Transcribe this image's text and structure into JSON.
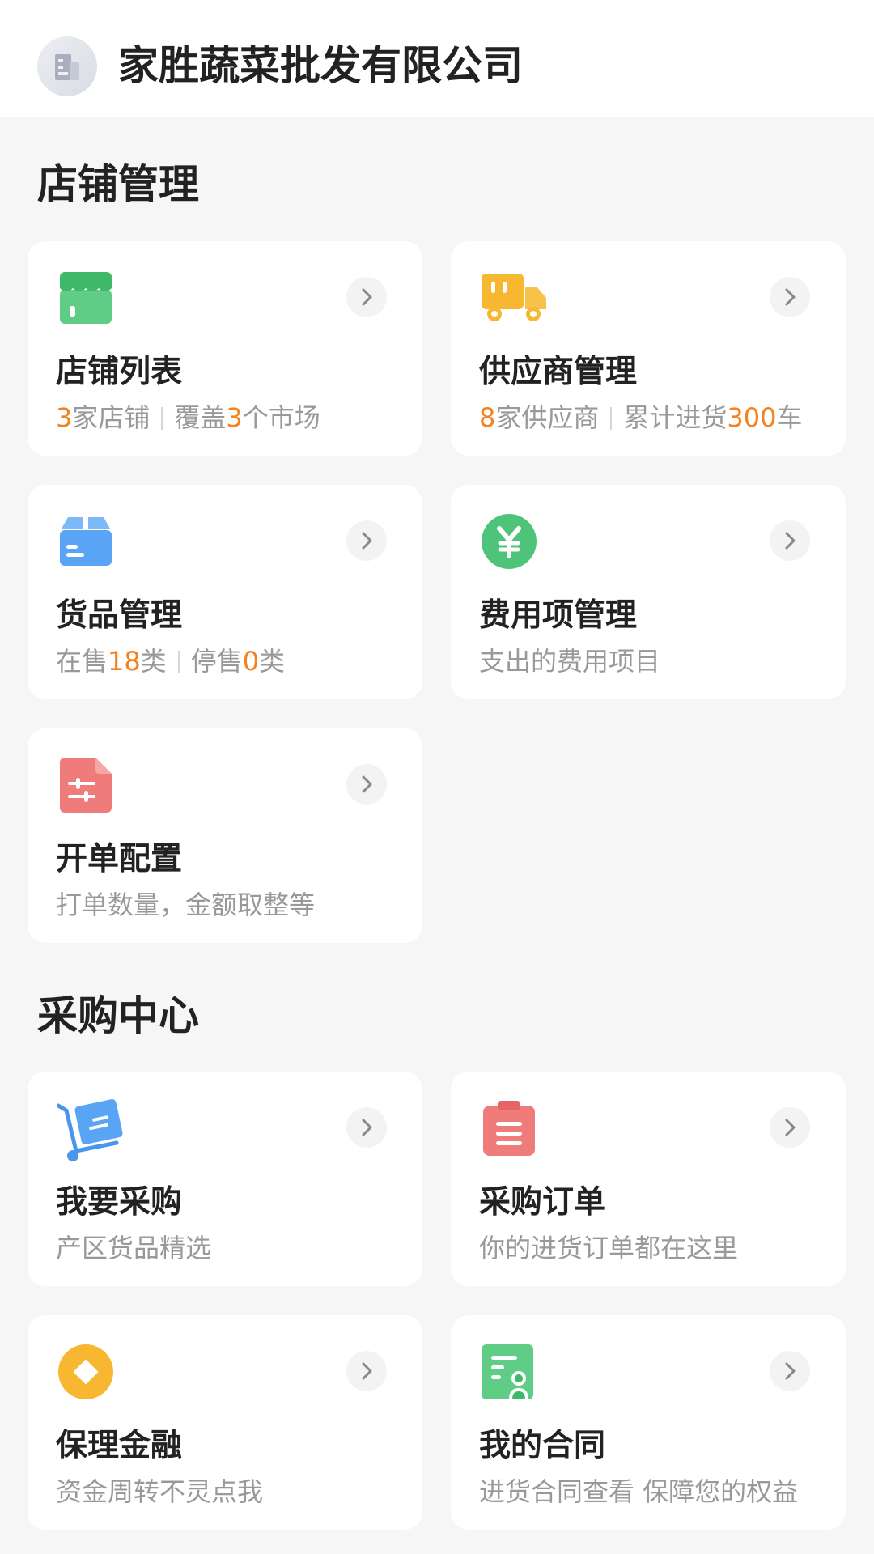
{
  "header": {
    "company_name": "家胜蔬菜批发有限公司",
    "logo_icon": "building-icon"
  },
  "colors": {
    "accent": "#f5821f",
    "page_bg": "#f6f6f6",
    "card_bg": "#ffffff",
    "subtext": "#999999"
  },
  "store_section": {
    "title": "店铺管理",
    "store_list": {
      "title": "店铺列表",
      "count": "3",
      "count_suffix": "家店铺",
      "cover_prefix": "覆盖",
      "cover_count": "3",
      "cover_suffix": "个市场",
      "icon": "storefront-icon"
    },
    "suppliers": {
      "title": "供应商管理",
      "count": "8",
      "count_suffix": "家供应商",
      "total_prefix": "累计进货",
      "total_count": "300",
      "total_suffix": "车",
      "icon": "truck-icon"
    },
    "goods": {
      "title": "货品管理",
      "on_sale_prefix": "在售",
      "on_sale_count": "18",
      "on_sale_suffix": "类",
      "off_sale_prefix": "停售",
      "off_sale_count": "0",
      "off_sale_suffix": "类",
      "icon": "box-icon"
    },
    "expenses": {
      "title": "费用项管理",
      "subtitle": "支出的费用项目",
      "icon": "yen-icon"
    },
    "billing": {
      "title": "开单配置",
      "subtitle": "打单数量，金额取整等",
      "icon": "settings-document-icon"
    }
  },
  "purchase_section": {
    "title": "采购中心",
    "buy": {
      "title": "我要采购",
      "subtitle": "产区货品精选",
      "icon": "cart-icon"
    },
    "orders": {
      "title": "采购订单",
      "subtitle": "你的进货订单都在这里",
      "icon": "clipboard-icon"
    },
    "factoring": {
      "title": "保理金融",
      "subtitle": "资金周转不灵点我",
      "icon": "diamond-coin-icon"
    },
    "contracts": {
      "title": "我的合同",
      "subtitle": "进货合同查看 保障您的权益",
      "icon": "contract-icon"
    }
  }
}
